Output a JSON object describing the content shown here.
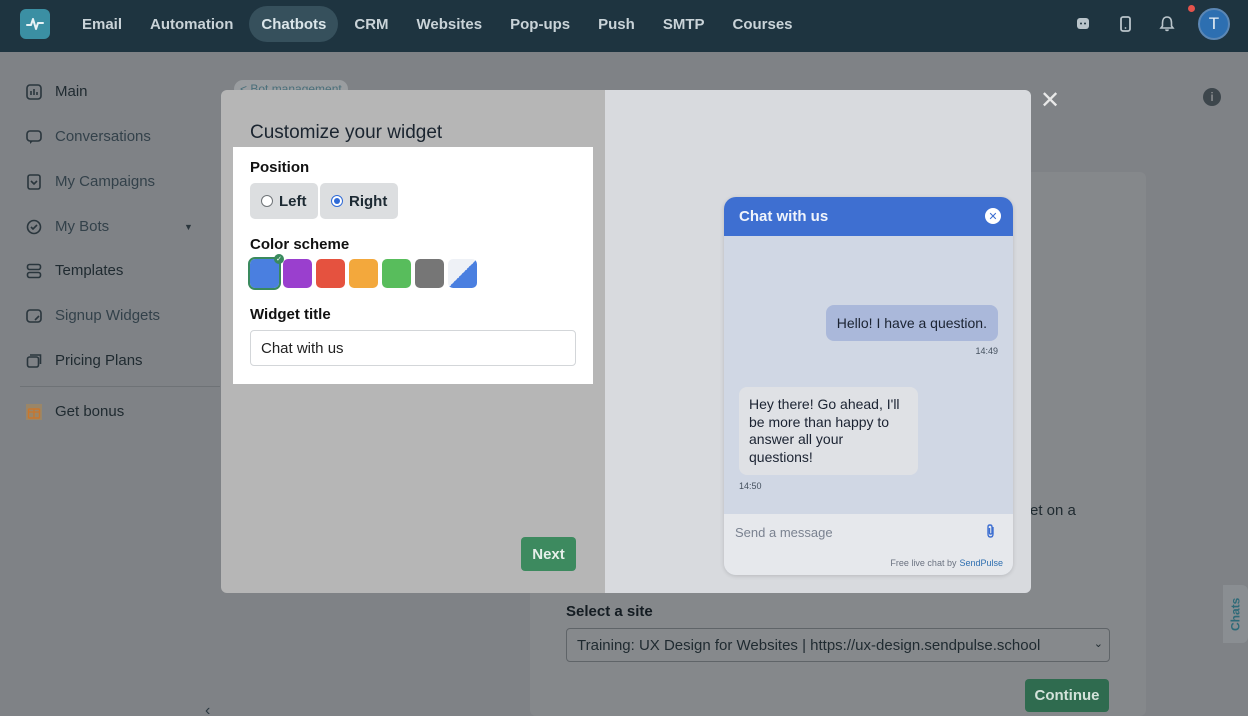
{
  "topnav": {
    "items": [
      "Email",
      "Automation",
      "Chatbots",
      "CRM",
      "Websites",
      "Pop-ups",
      "Push",
      "SMTP",
      "Courses"
    ],
    "active": "Chatbots",
    "avatar_initial": "T",
    "icons": [
      "chat-icon",
      "mobile-icon",
      "bell-icon"
    ]
  },
  "sidebar": {
    "items": [
      {
        "label": "Main",
        "icon": "dashboard-icon"
      },
      {
        "label": "Conversations",
        "icon": "chat-bubble-icon"
      },
      {
        "label": "My Campaigns",
        "icon": "campaign-icon"
      },
      {
        "label": "My Bots",
        "icon": "bot-icon"
      },
      {
        "label": "Templates",
        "icon": "templates-icon"
      },
      {
        "label": "Signup Widgets",
        "icon": "widget-icon"
      },
      {
        "label": "Pricing Plans",
        "icon": "pricing-icon"
      },
      {
        "label": "Get bonus",
        "icon": "gift-icon"
      }
    ]
  },
  "background": {
    "breadcrumb": "< Bot management",
    "partial_text": "et on a",
    "select_label": "Select a site",
    "site_value": "Training: UX Design for Websites | https://ux-design.sendpulse.school",
    "continue_label": "Continue",
    "chats_tab": "Chats"
  },
  "modal": {
    "title": "Customize your widget",
    "position_label": "Position",
    "position_options": [
      "Left",
      "Right"
    ],
    "position_selected": "Right",
    "color_label": "Color scheme",
    "colors": [
      "#4a7fe0",
      "#9a3fce",
      "#e5523f",
      "#f3a83c",
      "#58bd5c",
      "#767676",
      "split-blue-white"
    ],
    "color_selected": "#4a7fe0",
    "widget_title_label": "Widget title",
    "widget_title_value": "Chat with us",
    "next_label": "Next"
  },
  "preview": {
    "header": "Chat with us",
    "message_out": "Hello! I have a question.",
    "time_out": "14:49",
    "message_in": "Hey there! Go ahead, I'll be more than happy to answer all your questions!",
    "time_in": "14:50",
    "input_placeholder": "Send a message",
    "footer_text": "Free live chat by",
    "footer_brand": "SendPulse"
  }
}
